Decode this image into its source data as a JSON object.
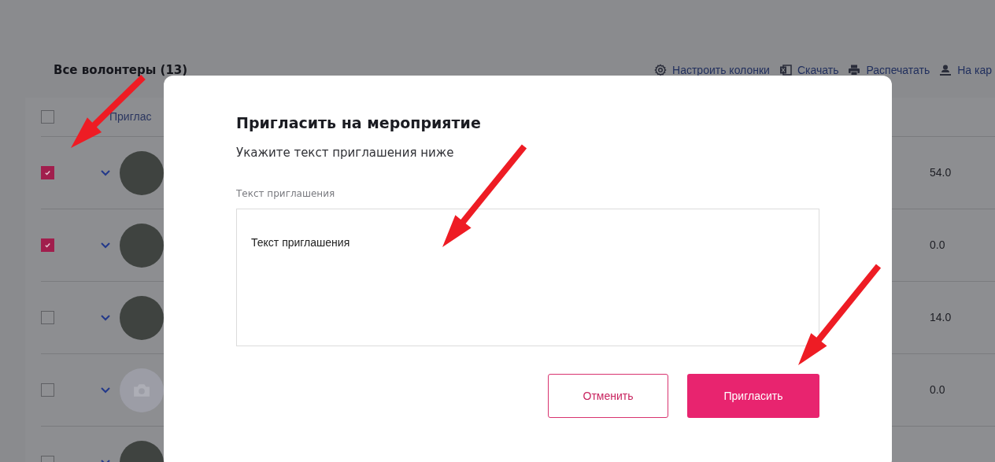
{
  "page": {
    "title": "Все волонтеры (13)",
    "actions": [
      {
        "label": "Настроить колонки"
      },
      {
        "label": "Скачать"
      },
      {
        "label": "Распечатать"
      },
      {
        "label": "На кар"
      }
    ]
  },
  "table": {
    "header": {
      "checked": false,
      "column_2": "Приглас"
    },
    "rows": [
      {
        "checked": true,
        "kind": "photo",
        "value": "54.0"
      },
      {
        "checked": true,
        "kind": "photo",
        "value": "0.0"
      },
      {
        "checked": false,
        "kind": "photo",
        "value": "14.0"
      },
      {
        "checked": false,
        "kind": "placeholder",
        "value": "0.0"
      },
      {
        "checked": false,
        "kind": "photo"
      }
    ]
  },
  "dialog": {
    "title": "Пригласить на мероприятие",
    "subtitle": "Укажите текст приглашения ниже",
    "field_label": "Текст приглашения",
    "field_value": "Текст приглашения",
    "buttons": [
      {
        "kind": "secondary",
        "label": "Отменить"
      },
      {
        "kind": "primary",
        "label": "Пригласить"
      }
    ]
  }
}
